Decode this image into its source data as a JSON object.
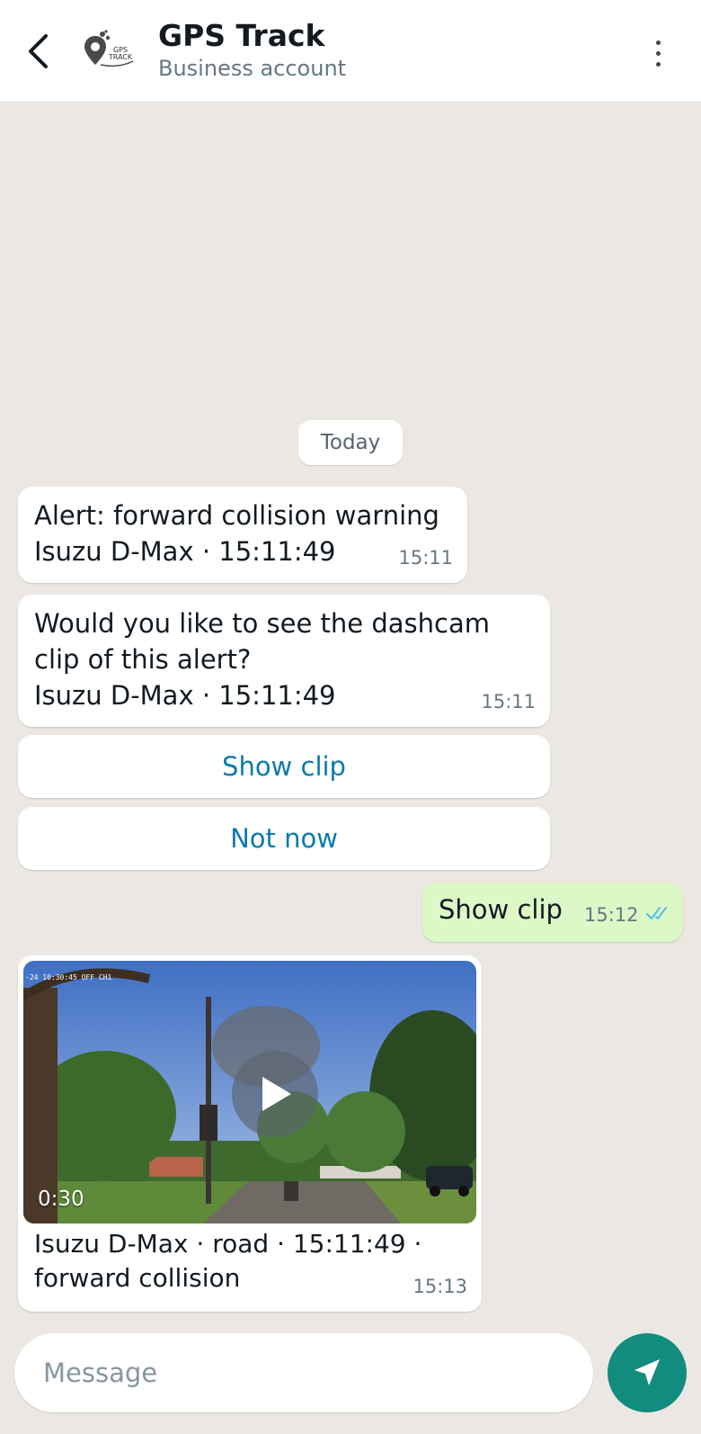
{
  "header": {
    "title": "GPS Track",
    "subtitle": "Business account",
    "avatar_logo_text": "GPS TRACK"
  },
  "chat": {
    "date_chip": "Today",
    "messages": [
      {
        "lines": [
          "Alert: forward collision warning",
          "Isuzu D-Max · 15:11:49"
        ],
        "time": "15:11"
      },
      {
        "lines": [
          "Would you like to see the dashcam",
          "clip of this alert?",
          "Isuzu D-Max · 15:11:49"
        ],
        "time": "15:11"
      }
    ],
    "quick_replies": [
      "Show clip",
      "Not now"
    ],
    "outgoing": {
      "text": "Show clip",
      "time": "15:12",
      "status": "read"
    },
    "video_message": {
      "duration": "0:30",
      "camera_stamp": "-24 10:30:45 OFF CH1",
      "caption_lines": [
        "Isuzu D-Max · road · 15:11:49 ·",
        "forward collision"
      ],
      "time": "15:13"
    }
  },
  "composer": {
    "placeholder": "Message"
  },
  "colors": {
    "chat_background": "#ebe7e2",
    "outgoing_bubble": "#dcf8c6",
    "link_text": "#0b7bab",
    "send_button": "#128c7e",
    "read_ticks": "#53bdeb"
  },
  "icons": [
    "back-arrow-icon",
    "more-vert-icon",
    "play-icon",
    "double-check-icon",
    "send-icon"
  ]
}
